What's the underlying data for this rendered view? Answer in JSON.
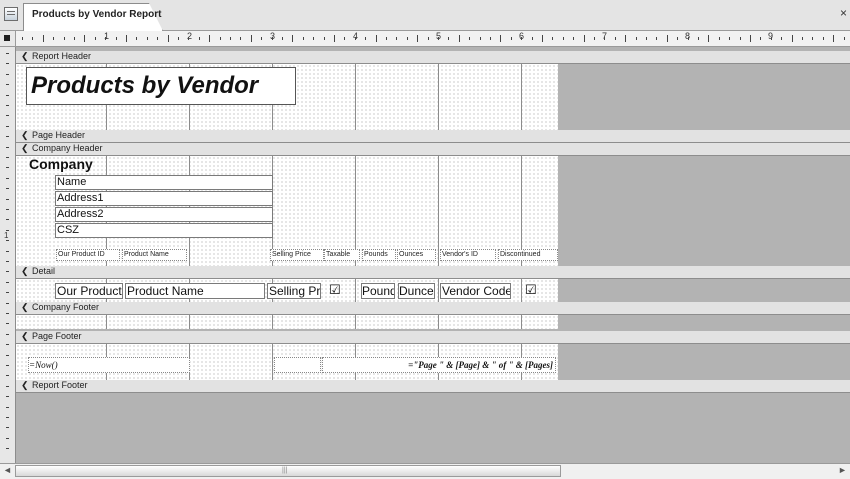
{
  "tab": {
    "title": "Products by Vendor Report"
  },
  "window": {
    "close_glyph": "×"
  },
  "ruler": {
    "numbers": [
      "1",
      "2",
      "3",
      "4",
      "5",
      "6",
      "7",
      "8",
      "9"
    ]
  },
  "sections": {
    "report_header": "Report Header",
    "page_header": "Page Header",
    "company_header": "Company Header",
    "detail": "Detail",
    "company_footer": "Company Footer",
    "page_footer": "Page Footer",
    "report_footer": "Report Footer",
    "arrow_glyph": "❮"
  },
  "report_header": {
    "title": "Products by Vendor"
  },
  "company_header": {
    "company": "Company",
    "fields": [
      "Name",
      "Address1",
      "Address2",
      "CSZ"
    ],
    "column_labels": [
      "Our Product ID",
      "Product Name",
      "Selling Price",
      "Taxable",
      "Pounds",
      "Ounces",
      "Vendor's ID",
      "Discontinued"
    ]
  },
  "detail": {
    "our_product": "Our Product",
    "product_name": "Product Name",
    "selling_price": "Selling Pri",
    "pounds": "Pounds",
    "ounces": "Dunces",
    "vendor_code": "Vendor Code",
    "checkbox_glyph": "☑"
  },
  "page_footer": {
    "now": "=Now()",
    "pages": "=\"Page \" & [Page] & \" of \" & [Pages]"
  },
  "vruler": {
    "mark": "1"
  },
  "scroll": {
    "left": "◄",
    "right": "►",
    "grip": "|||"
  }
}
